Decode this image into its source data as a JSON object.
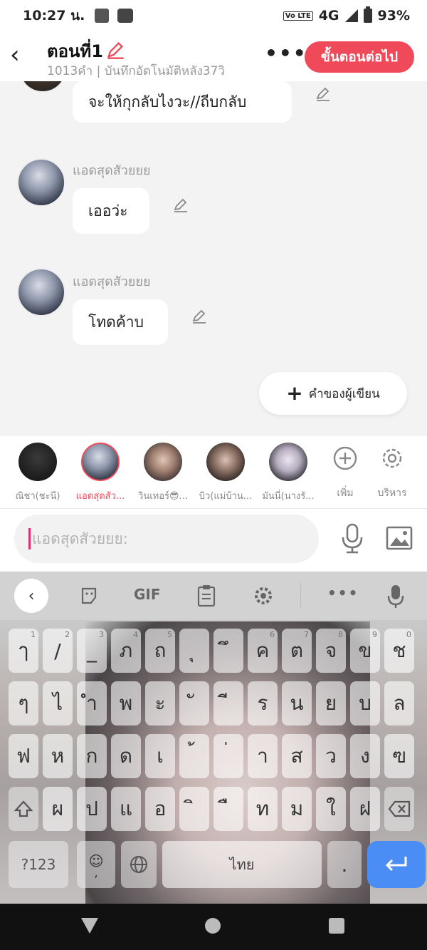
{
  "status": {
    "time": "10:27 น.",
    "network": "4G",
    "battery": "93%",
    "volte": "Vo LTE"
  },
  "header": {
    "title": "ตอนที่1",
    "subtitle": "1013คำ | บันทึกอัตโนมัติหลัง37วิ",
    "more_label": "•••",
    "next_label": "ขั้นตอนต่อไป"
  },
  "messages": [
    {
      "sender": "",
      "text": "จะให้กุกลับไงวะ//ถีบกลับ"
    },
    {
      "sender": "แอดสุดสัวยยย",
      "text": "เออว่ะ"
    },
    {
      "sender": "แอดสุดสัวยยย",
      "text": "โทดค้าบ"
    }
  ],
  "author_button": {
    "label": "คำของผู้เขียน"
  },
  "characters": [
    {
      "name": "ณิชา(ชะนี)"
    },
    {
      "name": "แอดสุดสัว..."
    },
    {
      "name": "วินเทอร์😎..."
    },
    {
      "name": "บิว(แม่บ้าน..."
    },
    {
      "name": "มันนี่(นางรั..."
    }
  ],
  "tools": {
    "add_label": "เพิ่ม",
    "manage_label": "บริหาร"
  },
  "input": {
    "placeholder": "แอดสุดสัวยยย:"
  },
  "keyboard": {
    "gif_label": "GIF",
    "space_label": "ไทย",
    "numbers_label": "?123",
    "row1": [
      "ๅ",
      "/",
      "_",
      "ภ",
      "ถ",
      "ุ",
      "ึ",
      "ค",
      "ต",
      "จ",
      "ข",
      "ช"
    ],
    "row1_hints": [
      "1",
      "2",
      "3",
      "4",
      "5",
      "",
      "",
      "6",
      "7",
      "8",
      "9",
      "0"
    ],
    "row2": [
      "ๆ",
      "ไ",
      "ำ",
      "พ",
      "ะ",
      "ั",
      "ี",
      "ร",
      "น",
      "ย",
      "บ",
      "ล"
    ],
    "row3": [
      "ฟ",
      "ห",
      "ก",
      "ด",
      "เ",
      "้",
      "่",
      "า",
      "ส",
      "ว",
      "ง",
      "ฃ"
    ],
    "row4": [
      "ผ",
      "ป",
      "แ",
      "อ",
      "ิ",
      "ื",
      "ท",
      "ม",
      "ใ",
      "ฝ"
    ]
  }
}
